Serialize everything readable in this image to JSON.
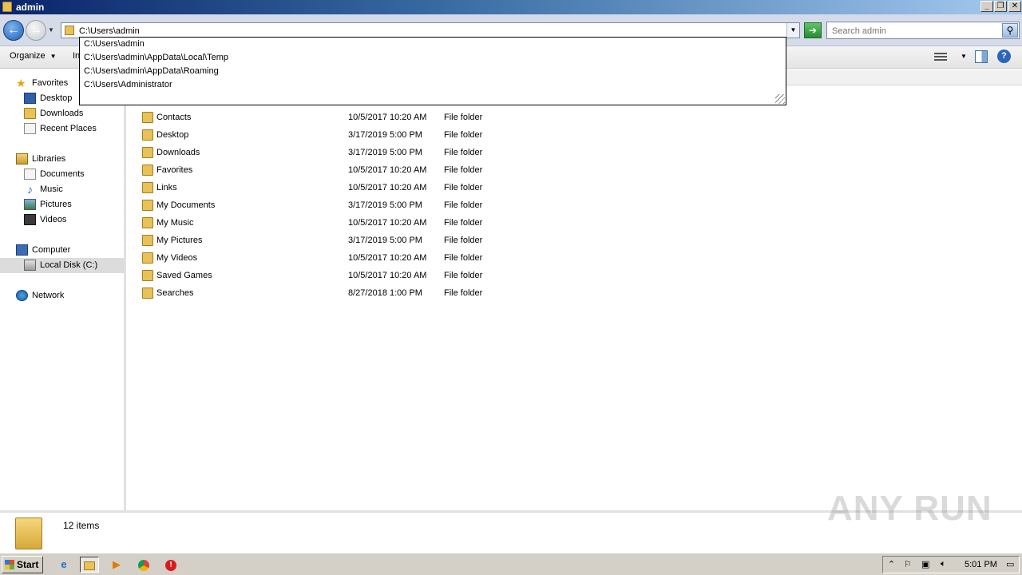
{
  "window": {
    "title": "admin",
    "min_label": "_",
    "max_label": "❐",
    "close_label": "✕"
  },
  "address": {
    "path": "C:\\Users\\admin",
    "suggestions": [
      "C:\\Users\\admin",
      "C:\\Users\\admin\\AppData\\Local\\Temp",
      "C:\\Users\\admin\\AppData\\Roaming",
      "C:\\Users\\Administrator"
    ]
  },
  "search": {
    "placeholder": "Search admin"
  },
  "toolbar": {
    "organize_label": "Organize",
    "partial_label": "In"
  },
  "nav": {
    "favorites": "Favorites",
    "favorites_items": [
      "Desktop",
      "Downloads",
      "Recent Places"
    ],
    "libraries": "Libraries",
    "libraries_items": [
      "Documents",
      "Music",
      "Pictures",
      "Videos"
    ],
    "computer": "Computer",
    "computer_items": [
      "Local Disk (C:)"
    ],
    "network": "Network"
  },
  "files": [
    {
      "name": "Contacts",
      "date": "10/5/2017 10:20 AM",
      "type": "File folder"
    },
    {
      "name": "Desktop",
      "date": "3/17/2019 5:00 PM",
      "type": "File folder"
    },
    {
      "name": "Downloads",
      "date": "3/17/2019 5:00 PM",
      "type": "File folder"
    },
    {
      "name": "Favorites",
      "date": "10/5/2017 10:20 AM",
      "type": "File folder"
    },
    {
      "name": "Links",
      "date": "10/5/2017 10:20 AM",
      "type": "File folder"
    },
    {
      "name": "My Documents",
      "date": "3/17/2019 5:00 PM",
      "type": "File folder"
    },
    {
      "name": "My Music",
      "date": "10/5/2017 10:20 AM",
      "type": "File folder"
    },
    {
      "name": "My Pictures",
      "date": "3/17/2019 5:00 PM",
      "type": "File folder"
    },
    {
      "name": "My Videos",
      "date": "10/5/2017 10:20 AM",
      "type": "File folder"
    },
    {
      "name": "Saved Games",
      "date": "10/5/2017 10:20 AM",
      "type": "File folder"
    },
    {
      "name": "Searches",
      "date": "8/27/2018 1:00 PM",
      "type": "File folder"
    }
  ],
  "details": {
    "count": "12 items"
  },
  "watermark": "ANY RUN",
  "taskbar": {
    "start_label": "Start",
    "clock": "5:01 PM"
  }
}
